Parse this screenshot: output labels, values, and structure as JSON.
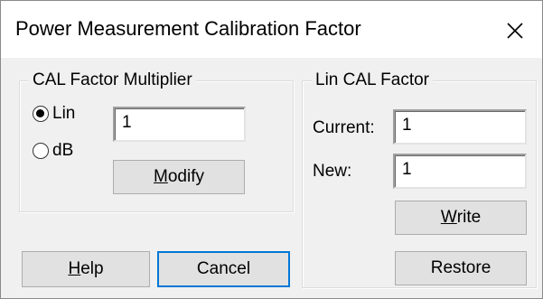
{
  "window": {
    "title": "Power Measurement Calibration Factor"
  },
  "multiplier": {
    "title": "CAL Factor Multiplier",
    "lin_label": "Lin",
    "db_label": "dB",
    "selected": "Lin",
    "value": "1",
    "modify": {
      "first": "M",
      "rest": "odify"
    }
  },
  "lin_cal": {
    "title": "Lin CAL Factor",
    "current_label": "Current:",
    "current_value": "1",
    "new_label": "New:",
    "new_value": "1",
    "write": {
      "first": "W",
      "rest": "rite"
    },
    "restore_label": "Restore"
  },
  "footer": {
    "help": {
      "first": "H",
      "rest": "elp"
    },
    "cancel_label": "Cancel"
  },
  "icons": {
    "close": "close-icon"
  },
  "colors": {
    "default_button_border": "#0078d7",
    "client_bg": "#f0f0f0"
  }
}
